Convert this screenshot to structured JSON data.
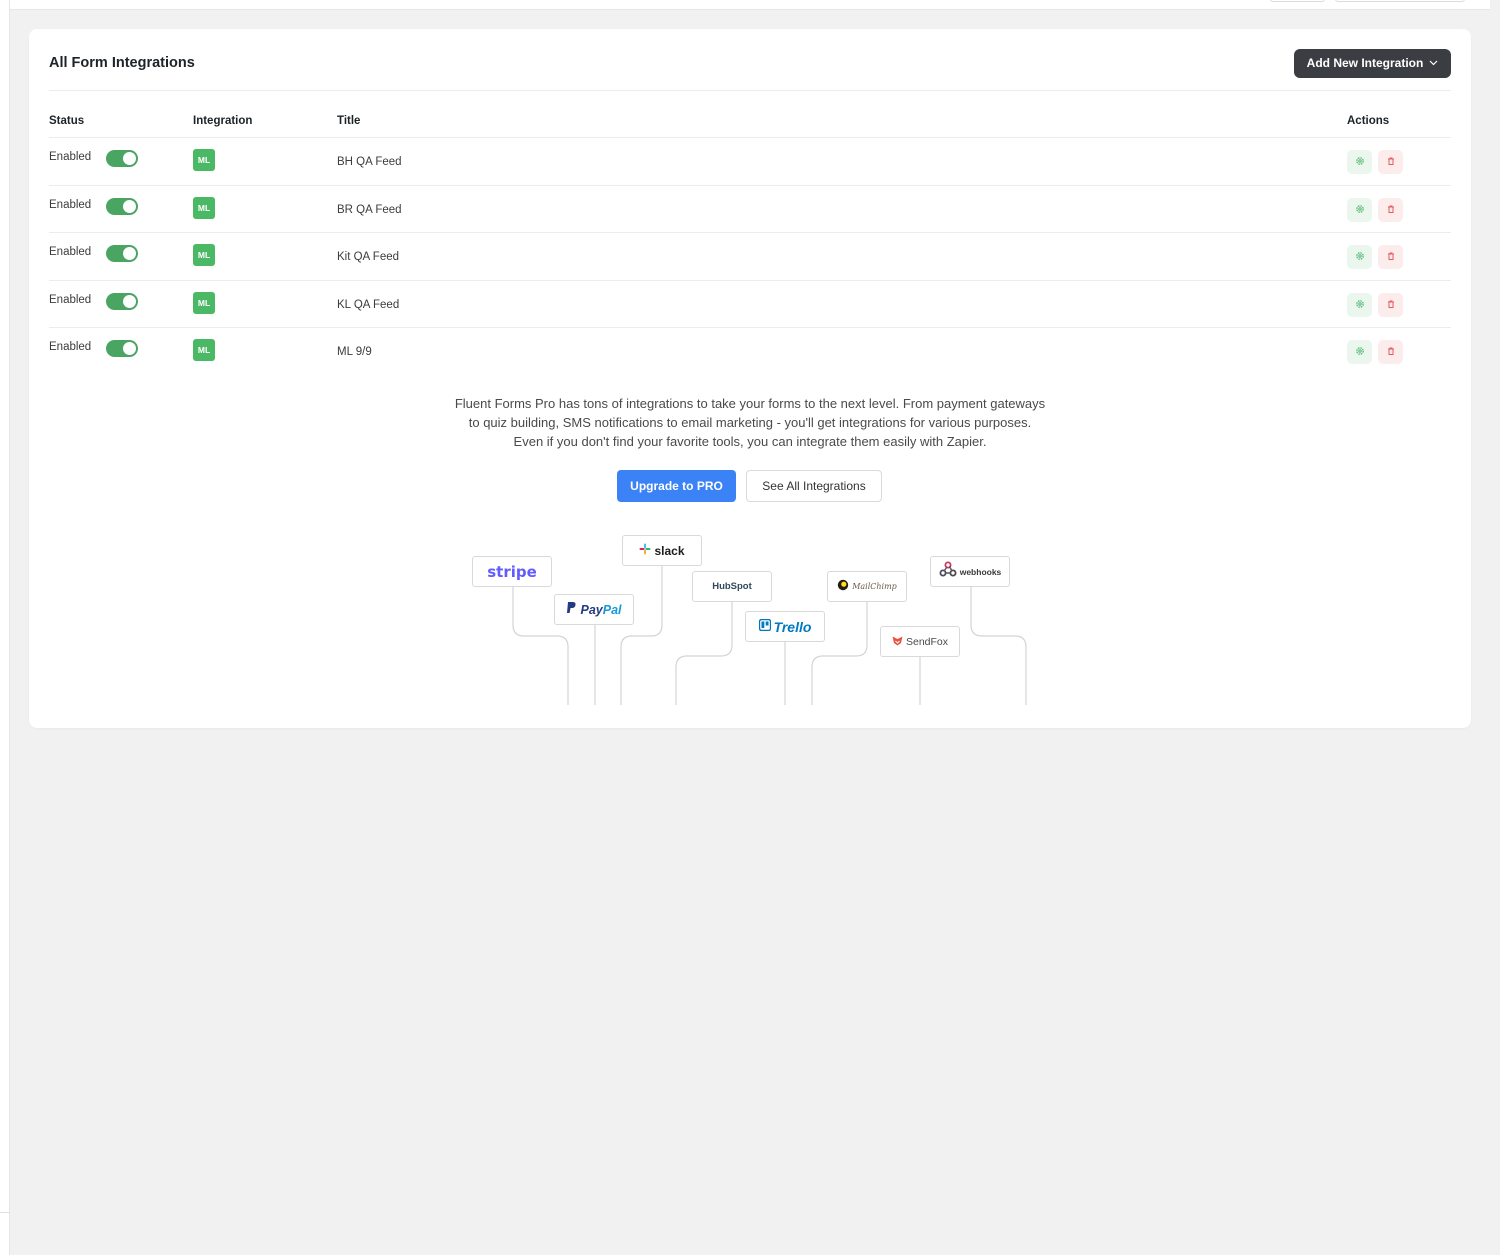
{
  "header": {
    "title": "All Form Integrations",
    "add_button_label": "Add New Integration"
  },
  "table": {
    "columns": {
      "status": "Status",
      "integration": "Integration",
      "title": "Title",
      "actions": "Actions"
    },
    "rows": [
      {
        "status": "Enabled",
        "enabled": true,
        "integration_badge": "ML",
        "title": "BH QA Feed"
      },
      {
        "status": "Enabled",
        "enabled": true,
        "integration_badge": "ML",
        "title": "BR QA Feed"
      },
      {
        "status": "Enabled",
        "enabled": true,
        "integration_badge": "ML",
        "title": "Kit QA Feed"
      },
      {
        "status": "Enabled",
        "enabled": true,
        "integration_badge": "ML",
        "title": "KL QA Feed"
      },
      {
        "status": "Enabled",
        "enabled": true,
        "integration_badge": "ML",
        "title": "ML 9/9"
      }
    ]
  },
  "promo": {
    "lines": [
      "Fluent Forms Pro has tons of integrations to take your forms to the next level. From payment gateways",
      "to quiz building, SMS notifications to email marketing - you'll get integrations for various purposes.",
      "Even if you don't find your favorite tools, you can integrate them easily with Zapier."
    ],
    "upgrade_label": "Upgrade to PRO",
    "see_all_label": "See All Integrations"
  },
  "logos": {
    "stripe": "stripe",
    "slack": "slack",
    "paypal_a": "Pay",
    "paypal_b": "Pal",
    "hubspot": "HubSpot",
    "trello": "Trello",
    "mailchimp": "MailChimp",
    "webhooks": "webhooks",
    "sendfox": "SendFox"
  },
  "colors": {
    "accent": "#3b82f6",
    "dark_button": "#3a3d42",
    "toggle_on": "#4aa462",
    "badge": "#4bb866",
    "danger": "#e35d5d"
  },
  "icons": {
    "settings": "gear-icon",
    "delete": "trash-icon",
    "dropdown": "chevron-down-icon"
  }
}
